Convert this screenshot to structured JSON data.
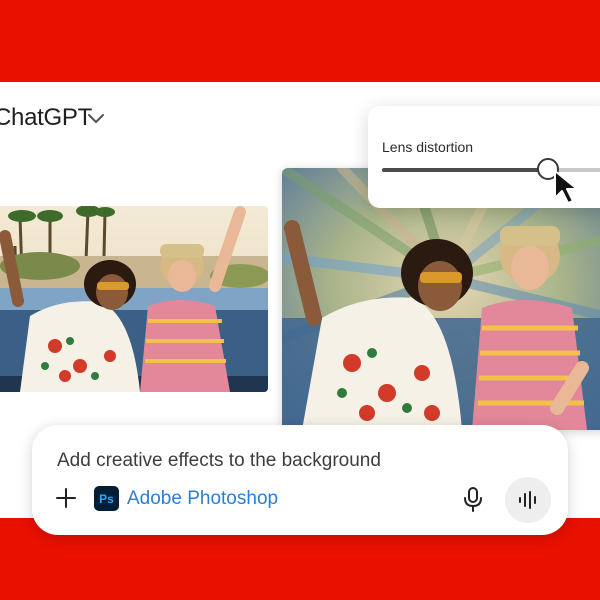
{
  "header": {
    "title": "ChatGPT"
  },
  "slider": {
    "label": "Lens distortion",
    "value_fraction": 0.69
  },
  "prompt": {
    "text": "Add creative effects to the background",
    "app_label": "Adobe Photoshop",
    "app_badge": "Ps"
  },
  "icons": [
    "chevron-down-icon",
    "cursor-arrow-icon",
    "plus-icon",
    "photoshop-icon",
    "microphone-icon",
    "voice-waveform-icon"
  ],
  "colors": {
    "brand_red": "#ea1000",
    "ps_badge_bg": "#001e36",
    "ps_badge_fg": "#31a8ff",
    "app_label": "#2a7ed8"
  }
}
